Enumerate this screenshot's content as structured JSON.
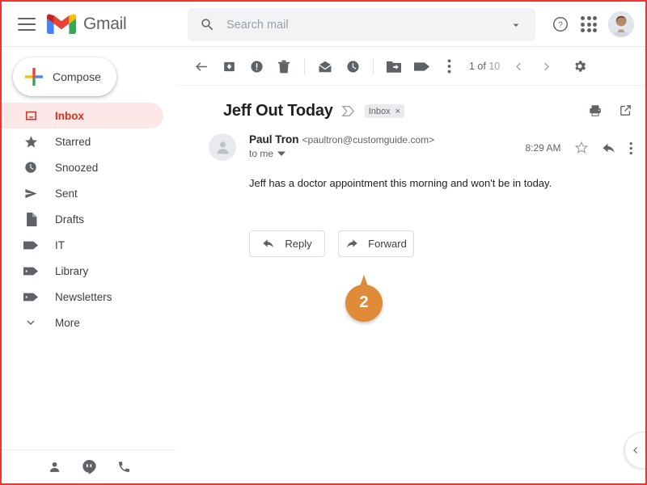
{
  "header": {
    "menu_icon": "hamburger-menu-icon",
    "logo_text": "Gmail",
    "logo_icon": "gmail-logo-icon",
    "help_icon": "help-circle-icon",
    "apps_icon": "apps-grid-icon",
    "avatar_icon": "user-avatar"
  },
  "search": {
    "placeholder": "Search mail",
    "value": "",
    "search_icon": "search-icon",
    "caret_icon": "chevron-down-icon"
  },
  "sidebar": {
    "compose_label": "Compose",
    "compose_icon": "plus-icon",
    "items": [
      {
        "label": "Inbox",
        "icon": "inbox-icon",
        "active": true
      },
      {
        "label": "Starred",
        "icon": "star-icon",
        "active": false
      },
      {
        "label": "Snoozed",
        "icon": "clock-icon",
        "active": false
      },
      {
        "label": "Sent",
        "icon": "send-icon",
        "active": false
      },
      {
        "label": "Drafts",
        "icon": "document-icon",
        "active": false
      },
      {
        "label": "IT",
        "icon": "label-icon",
        "active": false
      },
      {
        "label": "Library",
        "icon": "label-icon",
        "active": false
      },
      {
        "label": "Newsletters",
        "icon": "label-icon",
        "active": false
      },
      {
        "label": "More",
        "icon": "chevron-down-icon",
        "active": false
      }
    ],
    "bottom_icons": [
      "contacts-icon",
      "hangouts-icon",
      "phone-icon"
    ]
  },
  "toolbar": {
    "back_icon": "back-arrow-icon",
    "archive_icon": "archive-icon",
    "spam_icon": "report-spam-icon",
    "delete_icon": "trash-icon",
    "unread_icon": "mark-unread-icon",
    "snooze_icon": "snooze-clock-icon",
    "moveto_icon": "move-to-folder-icon",
    "labels_icon": "labels-tag-icon",
    "more_icon": "more-vertical-icon",
    "pager_current": "1 of ",
    "pager_total": "10",
    "prev_icon": "chevron-left-icon",
    "next_icon": "chevron-right-icon",
    "settings_icon": "gear-icon"
  },
  "email": {
    "subject": "Jeff Out Today",
    "subject_chevron_icon": "chevron-expand-icon",
    "label_chip": "Inbox",
    "label_chip_remove": "×",
    "print_icon": "printer-icon",
    "popout_icon": "open-in-new-icon",
    "avatar_icon": "person-avatar-icon",
    "sender_name": "Paul Tron",
    "sender_email": "<paultron@customguide.com>",
    "recipient": "to me",
    "recipient_caret_icon": "caret-down-icon",
    "time": "8:29 AM",
    "star_icon": "star-outline-icon",
    "reply_icon": "reply-arrow-icon",
    "more_icon": "more-vertical-icon",
    "body": "Jeff has a doctor appointment this morning and won't be in today."
  },
  "actions": {
    "reply_label": "Reply",
    "reply_icon": "reply-arrow-icon",
    "forward_label": "Forward",
    "forward_icon": "forward-arrow-icon"
  },
  "callout": {
    "number": "2"
  },
  "right_tab": {
    "icon": "chevron-left-icon"
  },
  "colors": {
    "gmail_red": "#d93025",
    "active_pill": "#fce8e6",
    "icon_gray": "#5f6368",
    "callout_orange": "#e08b38",
    "frame_red": "#e53935"
  }
}
